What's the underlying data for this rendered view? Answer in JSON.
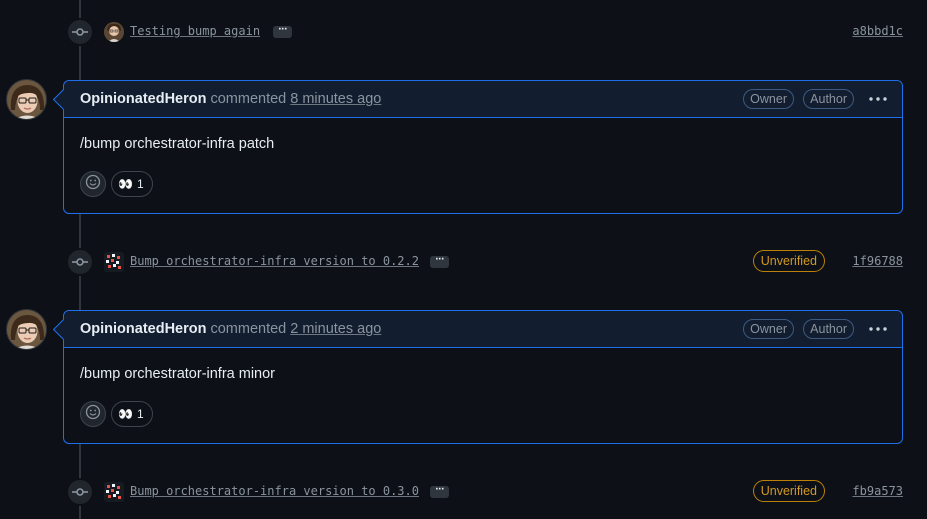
{
  "commits": [
    {
      "message": "Testing bump again",
      "author_avatar": "user-avatar-icon",
      "show_unverified": false,
      "sha": "a8bbd1c"
    },
    {
      "message": "Bump orchestrator-infra version to 0.2.2",
      "author_avatar": "bot-avatar-icon",
      "show_unverified": true,
      "unverified_label": "Unverified",
      "sha": "1f96788"
    },
    {
      "message": "Bump orchestrator-infra version to 0.3.0",
      "author_avatar": "bot-avatar-icon",
      "show_unverified": true,
      "unverified_label": "Unverified",
      "sha": "fb9a573"
    }
  ],
  "comments": [
    {
      "author": "OpinionatedHeron",
      "action": "commented",
      "time": "8 minutes ago",
      "labels": [
        "Owner",
        "Author"
      ],
      "body": "/bump orchestrator-infra patch",
      "reaction": {
        "emoji": "👀",
        "count": "1"
      }
    },
    {
      "author": "OpinionatedHeron",
      "action": "commented",
      "time": "2 minutes ago",
      "labels": [
        "Owner",
        "Author"
      ],
      "body": "/bump orchestrator-infra minor",
      "reaction": {
        "emoji": "👀",
        "count": "1"
      }
    }
  ],
  "icons": {
    "commit": "git-commit-icon",
    "more": "kebab-horizontal-icon",
    "add_reaction": "smiley-icon"
  },
  "colors": {
    "background": "#0d1117",
    "accent_border": "#1f6feb",
    "header_bg": "#121d2f",
    "unverified": "#d29922",
    "muted_text": "#8b949e"
  }
}
